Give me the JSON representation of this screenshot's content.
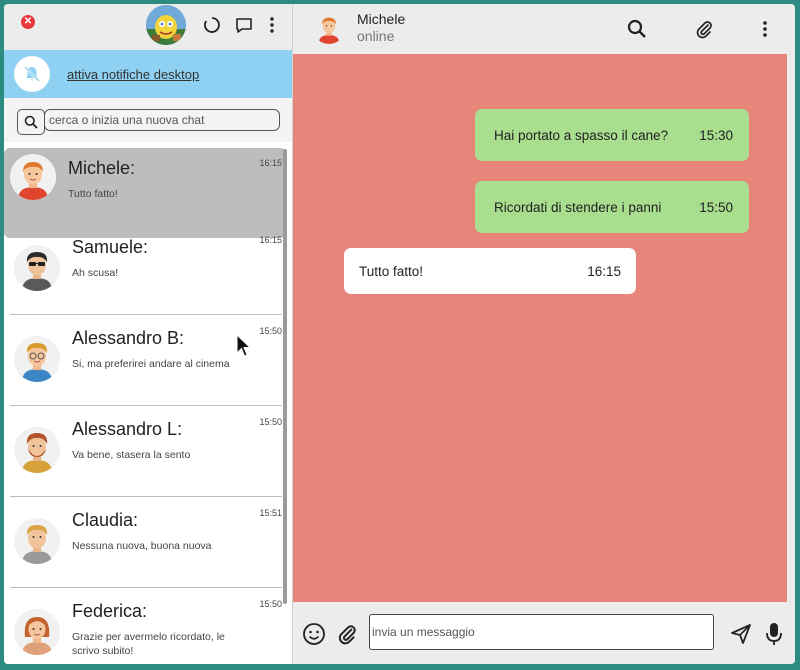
{
  "header": {
    "close_icon": "close-icon",
    "icons": [
      "status-circle-icon",
      "new-chat-icon",
      "menu-dots-icon"
    ]
  },
  "notifications": {
    "label": "attiva notifiche desktop",
    "icon": "bell-off-icon"
  },
  "search": {
    "placeholder": "cerca o inizia una nuova chat",
    "icon": "search-icon"
  },
  "chats": [
    {
      "name": "Michele:",
      "time": "16:15",
      "preview": "Tutto fatto!",
      "active": true
    },
    {
      "name": "Samuele:",
      "time": "16:15",
      "preview": "Ah scusa!"
    },
    {
      "name": "Alessandro B:",
      "time": "15:50",
      "preview": "Si, ma preferirei andare al cinema"
    },
    {
      "name": "Alessandro L:",
      "time": "15:50",
      "preview": "Va bene, stasera la sento"
    },
    {
      "name": "Claudia:",
      "time": "15:51",
      "preview": "Nessuna nuova, buona nuova"
    },
    {
      "name": "Federica:",
      "time": "15:50",
      "preview": "Grazie per avermelo ricordato, le scrivo subito!"
    }
  ],
  "conversation": {
    "contact_name": "Michele",
    "contact_status": "online",
    "messages": [
      {
        "text": "Hai portato a spasso il cane?",
        "time": "15:30",
        "type": "sent"
      },
      {
        "text": "Ricordati di stendere i panni",
        "time": "15:50",
        "type": "sent"
      },
      {
        "text": "Tutto fatto!",
        "time": "16:15",
        "type": "received"
      }
    ]
  },
  "composer": {
    "placeholder": "invia un messaggio"
  },
  "colors": {
    "chat_background": "#e8857a",
    "sent_bubble": "#a8de8e",
    "received_bubble": "#ffffff",
    "notification_bar": "#8fd1f2",
    "active_chat": "#bdbdbd",
    "close_button": "#e8373c"
  }
}
